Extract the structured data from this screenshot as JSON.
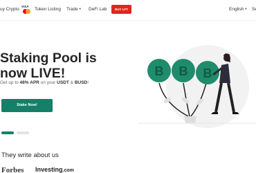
{
  "header": {
    "buy_crypto": "uy Crypto",
    "card_logo_text": "VISA",
    "token_listing": "Token Listing",
    "trade": "Trade",
    "defi_lab": "DeFi Lab",
    "buy_button": "BUY LFT",
    "language": "English",
    "more": "Se"
  },
  "hero": {
    "title_line1": "Staking Pool is",
    "title_line2": "now LIVE!",
    "subtitle_prefix": "Get up to ",
    "subtitle_apr": "48% APR",
    "subtitle_mid": " on your ",
    "subtitle_usdt": "USDT",
    "subtitle_and": " & ",
    "subtitle_busd": "BUSD",
    "subtitle_end": "!",
    "cta": "Stake Now!",
    "coin_symbol": "B"
  },
  "carousel": {
    "slides": 2,
    "active": 1
  },
  "press": {
    "title": "They write about us",
    "logo1": "Forbes",
    "logo2": "Investing",
    "logo2_suffix": ".com"
  },
  "colors": {
    "accent": "#138067",
    "buy": "#e0261e",
    "coin": "#1f8c6b"
  }
}
